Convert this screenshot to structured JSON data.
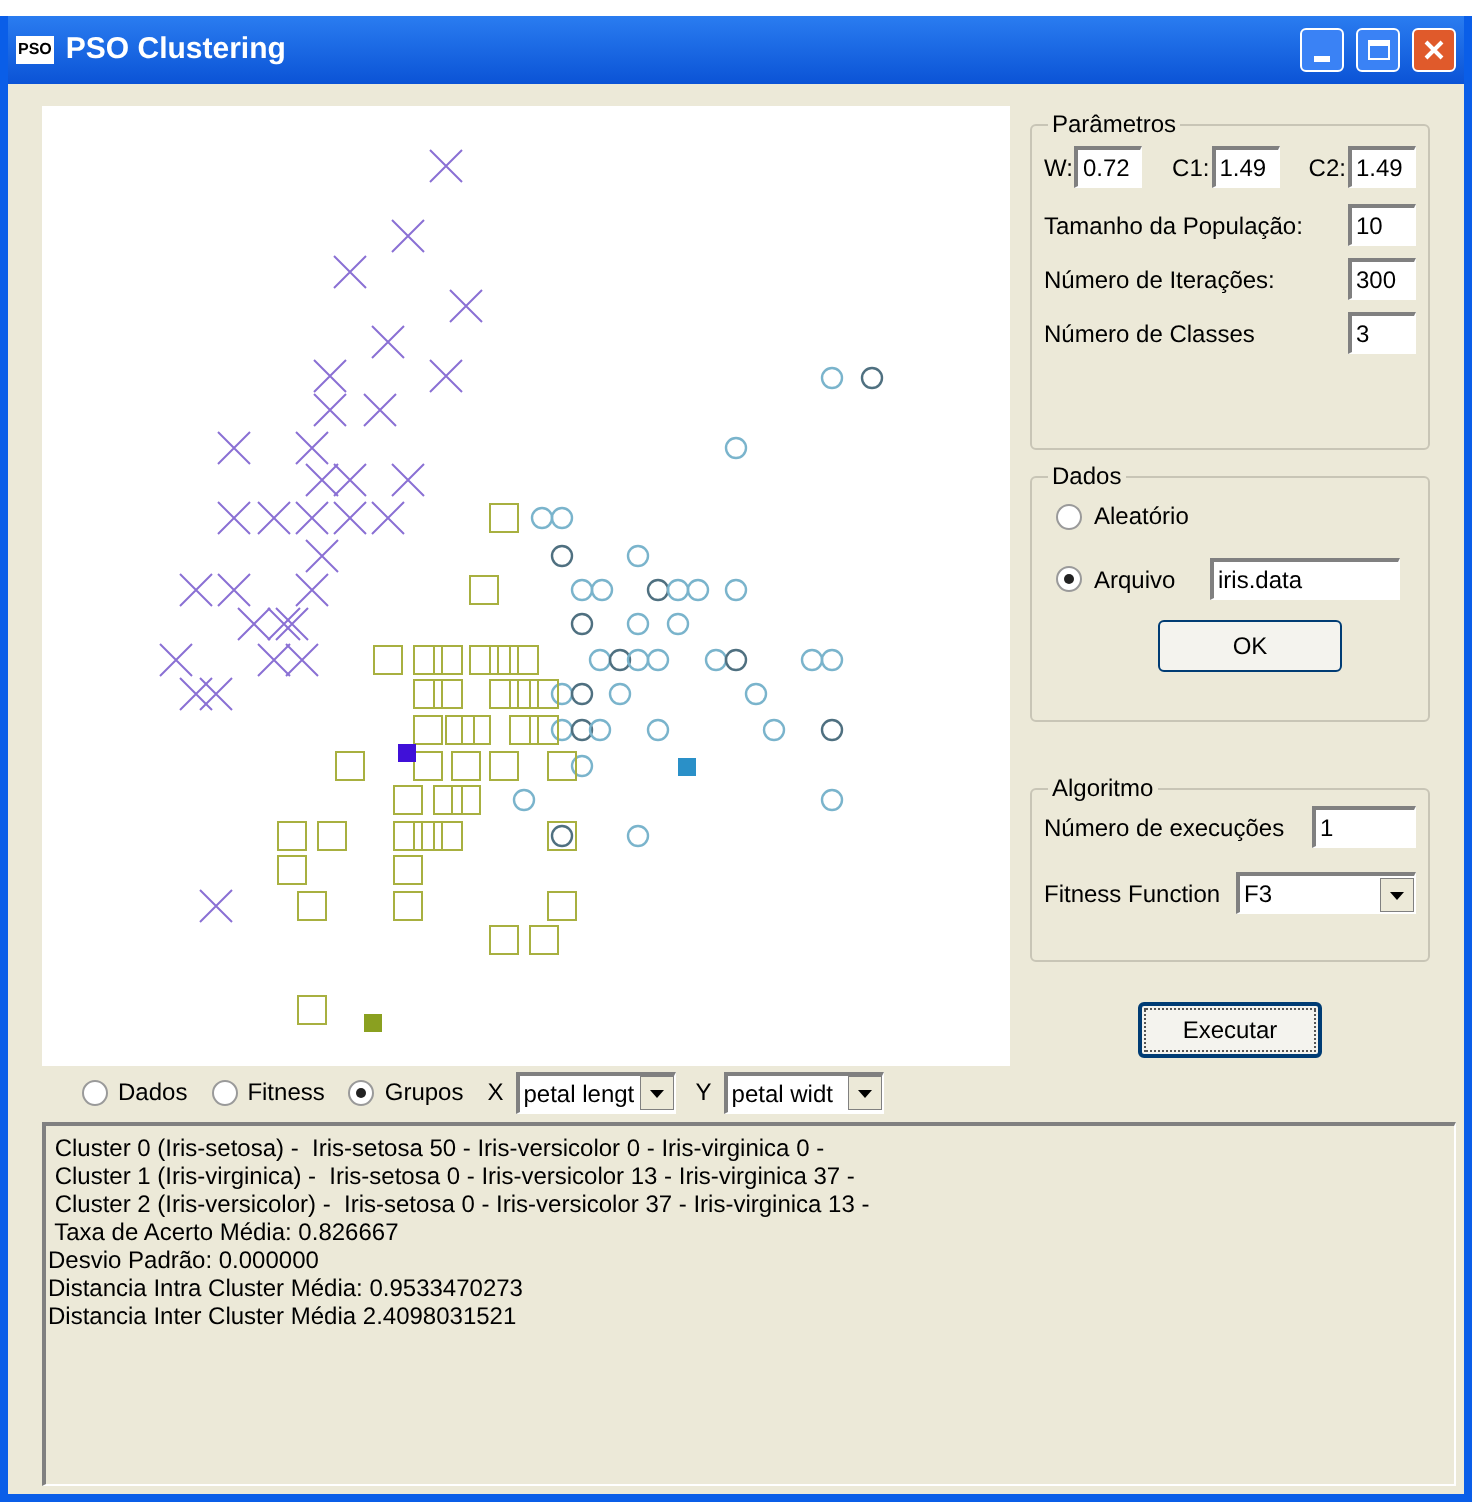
{
  "window": {
    "title": "PSO Clustering",
    "icon_text": "PSO"
  },
  "parametros": {
    "title": "Parâmetros",
    "coefficients": [
      {
        "label": "W:",
        "value": "0.72"
      },
      {
        "label": "C1:",
        "value": "1.49"
      },
      {
        "label": "C2:",
        "value": "1.49"
      }
    ],
    "fields": [
      {
        "label": "Tamanho da População:",
        "value": "10"
      },
      {
        "label": "Número de Iterações:",
        "value": "300"
      },
      {
        "label": "Número de Classes",
        "value": "3"
      }
    ]
  },
  "dados": {
    "title": "Dados",
    "options": [
      {
        "label": "Aleatório",
        "selected": false
      },
      {
        "label": "Arquivo",
        "selected": true
      }
    ],
    "file": "iris.data",
    "button": "OK"
  },
  "algoritmo": {
    "title": "Algoritmo",
    "executions": {
      "label": "Número de execuções",
      "value": "1"
    },
    "fitness": {
      "label": "Fitness Function",
      "value": "F3"
    }
  },
  "run_button": "Executar",
  "view": {
    "options": [
      {
        "label": "Dados",
        "selected": false
      },
      {
        "label": "Fitness",
        "selected": false
      },
      {
        "label": "Grupos",
        "selected": true
      }
    ],
    "x_axis": {
      "label": "X",
      "value": "petal lengt"
    },
    "y_axis": {
      "label": "Y",
      "value": "petal widt"
    }
  },
  "output": [
    " Cluster 0 (Iris-setosa) -  Iris-setosa 50 - Iris-versicolor 0 - Iris-virginica 0 -",
    " Cluster 1 (Iris-virginica) -  Iris-setosa 0 - Iris-versicolor 13 - Iris-virginica 37 -",
    " Cluster 2 (Iris-versicolor) -  Iris-setosa 0 - Iris-versicolor 37 - Iris-virginica 13 -",
    " Taxa de Acerto Média: 0.826667",
    "Desvio Padrão: 0.000000",
    "Distancia Intra Cluster Média: 0.9533470273",
    "Distancia Inter Cluster Média 2.4098031521"
  ]
}
